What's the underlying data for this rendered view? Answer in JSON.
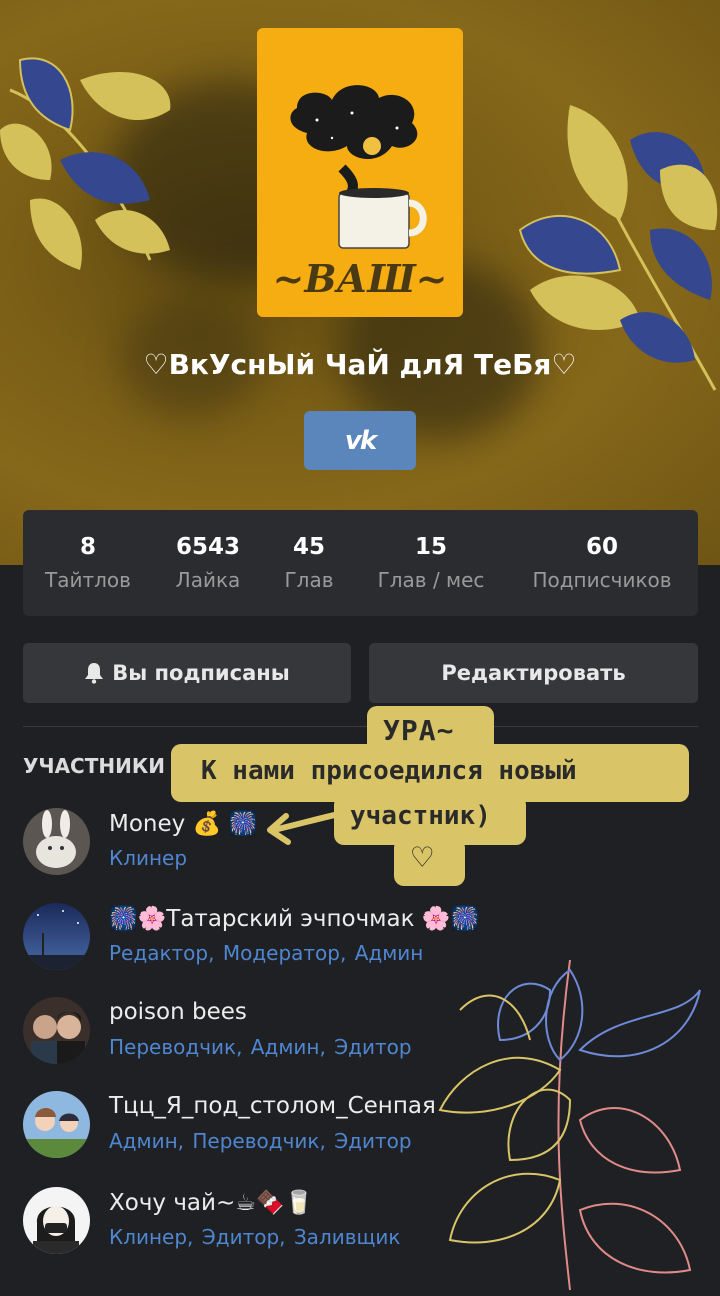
{
  "team": {
    "cover_caption": "~ВАШ~",
    "name": "♡ВкУснЫй ЧаЙ длЯ ТеБя♡",
    "social": "vk"
  },
  "stats": [
    {
      "value": "8",
      "label": "Тайтлов"
    },
    {
      "value": "6543",
      "label": "Лайка"
    },
    {
      "value": "45",
      "label": "Глав"
    },
    {
      "value": "15",
      "label": "Глав / мес"
    },
    {
      "value": "60",
      "label": "Подписчиков"
    }
  ],
  "actions": {
    "subscribed_label": "Вы подписаны",
    "subscribed_icon": "bell-icon",
    "edit_label": "Редактировать"
  },
  "members_section": {
    "title": "УЧАСТНИКИ",
    "count": "5"
  },
  "members": [
    {
      "name": "Money 💰 🎆",
      "roles": "Клинер"
    },
    {
      "name": "🎆🌸Татарский эчпочмак 🌸🎆",
      "roles": "Редактор,  Модератор,  Админ"
    },
    {
      "name": "poison bees",
      "roles": "Переводчик,  Админ,  Эдитор"
    },
    {
      "name": "Тцц_Я_под_столом_Сенпая",
      "roles": "Админ,  Переводчик,  Эдитор"
    },
    {
      "name": "Хочу чай~☕🍫🥛",
      "roles": "Клинер,  Эдитор,  Заливщик"
    }
  ],
  "annotation": {
    "line1": "УРА~",
    "line2": "К нами присоедился новый",
    "line3": "участник)",
    "heart": "♡"
  },
  "colors": {
    "banner": "#86681a",
    "cover": "#f6ad12",
    "vk_button": "#5a86bb",
    "role_link": "#4f86d0",
    "note": "#d9c567",
    "leaf_yellow": "#d4c15a",
    "leaf_blue": "#34478f"
  }
}
